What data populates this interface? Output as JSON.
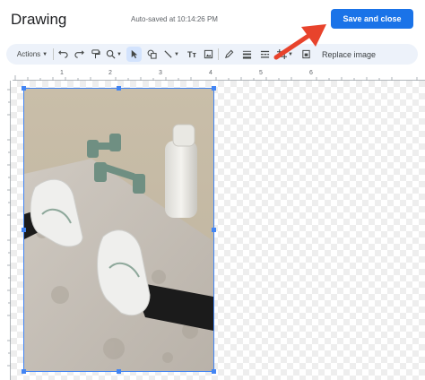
{
  "header": {
    "title": "Drawing",
    "autosave": "Auto-saved at 10:14:26 PM",
    "save_label": "Save and close"
  },
  "toolbar": {
    "actions_label": "Actions",
    "replace_label": "Replace image",
    "icons": [
      "undo-icon",
      "redo-icon",
      "paint-format-icon",
      "zoom-icon",
      "select-icon",
      "shape-icon",
      "line-icon",
      "text-box-icon",
      "image-icon",
      "pen-icon",
      "line-weight-icon",
      "line-dash-icon",
      "crop-icon",
      "reset-image-icon"
    ]
  },
  "rulers": {
    "horizontal_marks": [
      "1",
      "2",
      "3",
      "4",
      "5",
      "6"
    ],
    "vertical_marks": []
  },
  "colors": {
    "accent": "#1a73e8",
    "toolbar_bg": "#edf2fa",
    "selection": "#4285f4",
    "annotation_arrow": "#e8432c"
  }
}
